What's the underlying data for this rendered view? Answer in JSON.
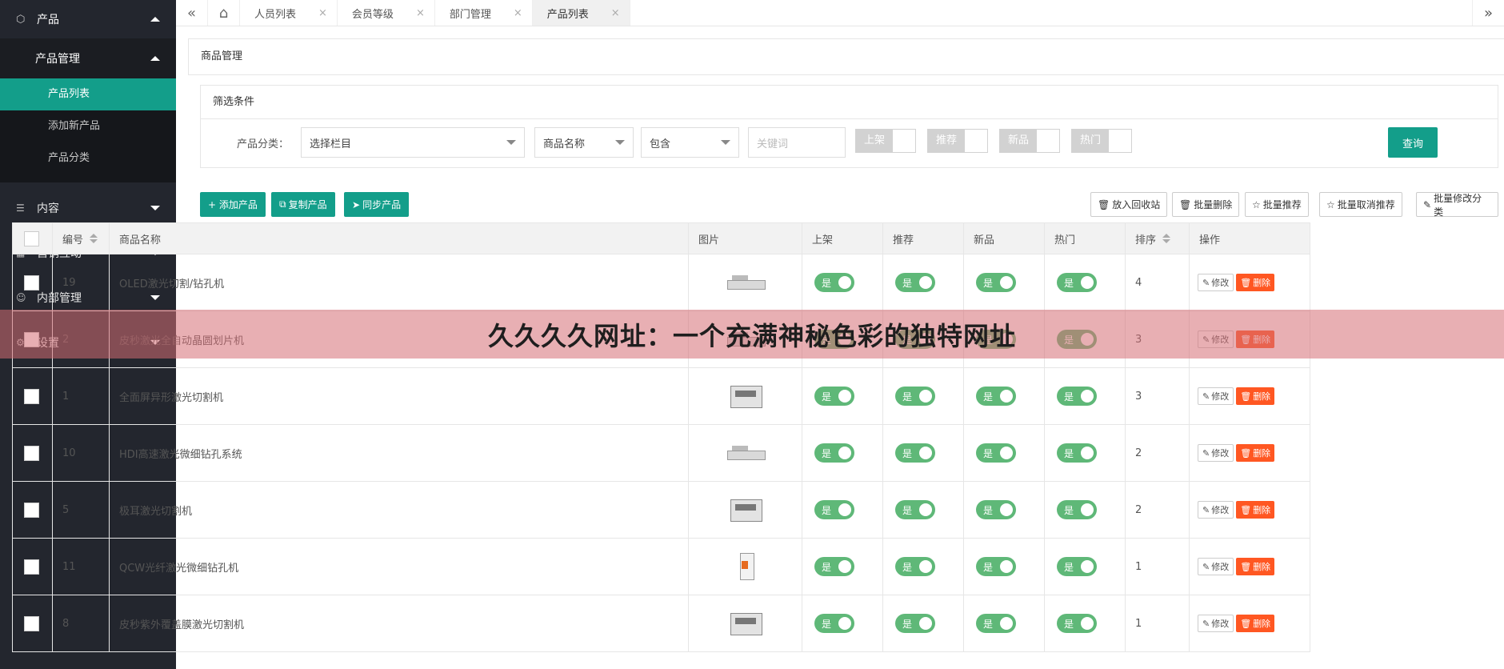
{
  "sidebar": {
    "product": {
      "label": "产品",
      "icon": "cube-icon"
    },
    "product_mgmt": {
      "label": "产品管理"
    },
    "links": [
      {
        "label": "产品列表",
        "active": true
      },
      {
        "label": "添加新产品",
        "active": false
      },
      {
        "label": "产品分类",
        "active": false
      }
    ],
    "items": [
      {
        "label": "内容",
        "icon": "content-icon"
      },
      {
        "label": "营销互动",
        "icon": "marketing-icon"
      },
      {
        "label": "内部管理",
        "icon": "user-icon"
      },
      {
        "label": "设置",
        "icon": "gear-icon"
      }
    ]
  },
  "tabs": [
    {
      "label": "人员列表",
      "close": "×",
      "active": false
    },
    {
      "label": "会员等级",
      "close": "×",
      "active": false
    },
    {
      "label": "部门管理",
      "close": "×",
      "active": false
    },
    {
      "label": "产品列表",
      "close": "×",
      "active": true
    }
  ],
  "page_title": "商品管理",
  "filter": {
    "title": "筛选条件",
    "category_label": "产品分类：",
    "category_value": "选择栏目",
    "field_value": "商品名称",
    "match_value": "包含",
    "keyword_placeholder": "关键词",
    "switches": [
      "上架",
      "推荐",
      "新品",
      "热门"
    ],
    "query_label": "查询"
  },
  "toolbar": {
    "add": "+ 添加产品",
    "copy": "复制产品",
    "sync": "同步产品",
    "recycle": "放入回收站",
    "batch_delete": "批量删除",
    "batch_recommend": "批量推荐",
    "batch_unrecommend": "批量取消推荐",
    "batch_category": "批量修改分类"
  },
  "table": {
    "headers": [
      "编号",
      "商品名称",
      "图片",
      "上架",
      "推荐",
      "新品",
      "热门",
      "排序",
      "操作"
    ],
    "toggle_label": "是",
    "edit_label": "修改",
    "delete_label": "删除",
    "rows": [
      {
        "id": "19",
        "name": "OLED激光切割/钻孔机",
        "sort": "4",
        "img": "wide"
      },
      {
        "id": "2",
        "name": "皮秒激光全自动晶圆划片机",
        "sort": "3",
        "img": "wide"
      },
      {
        "id": "1",
        "name": "全面屏异形激光切割机",
        "sort": "3",
        "img": "box"
      },
      {
        "id": "10",
        "name": "HDI高速激光微细钻孔系统",
        "sort": "2",
        "img": "wide"
      },
      {
        "id": "5",
        "name": "极耳激光切割机",
        "sort": "2",
        "img": "box"
      },
      {
        "id": "11",
        "name": "QCW光纤激光微细钻孔机",
        "sort": "1",
        "img": "tall"
      },
      {
        "id": "8",
        "name": "皮秒紫外覆盖膜激光切割机",
        "sort": "1",
        "img": "box"
      }
    ]
  },
  "banner": "久久久久网址：一个充满神秘色彩的独特网址",
  "colors": {
    "sidebar": "#23262e",
    "accent": "#139e8a",
    "toggle": "#5fb878",
    "delete": "#ff5722",
    "banner": "#d66e74"
  }
}
